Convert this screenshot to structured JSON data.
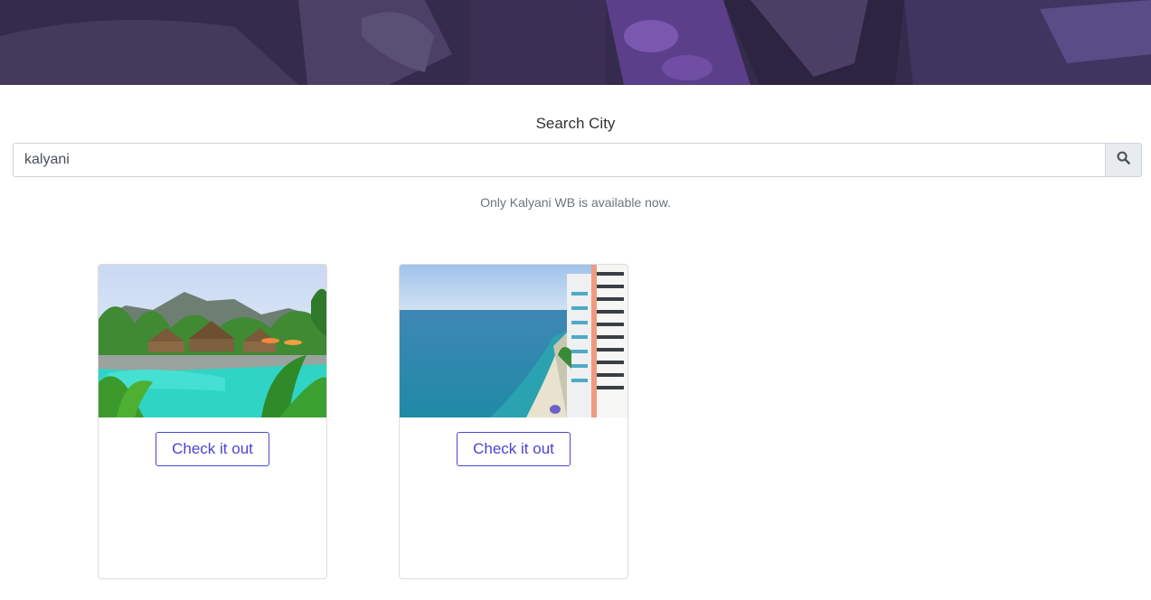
{
  "search": {
    "label": "Search City",
    "value": "kalyani",
    "note": "Only Kalyani WB is available now."
  },
  "cards": [
    {
      "image": "resort-pool-image",
      "button_label": "Check it out"
    },
    {
      "image": "beach-hotel-image",
      "button_label": "Check it out"
    }
  ],
  "colors": {
    "accent": "#4b44d1",
    "hero": "#3a2f55"
  }
}
